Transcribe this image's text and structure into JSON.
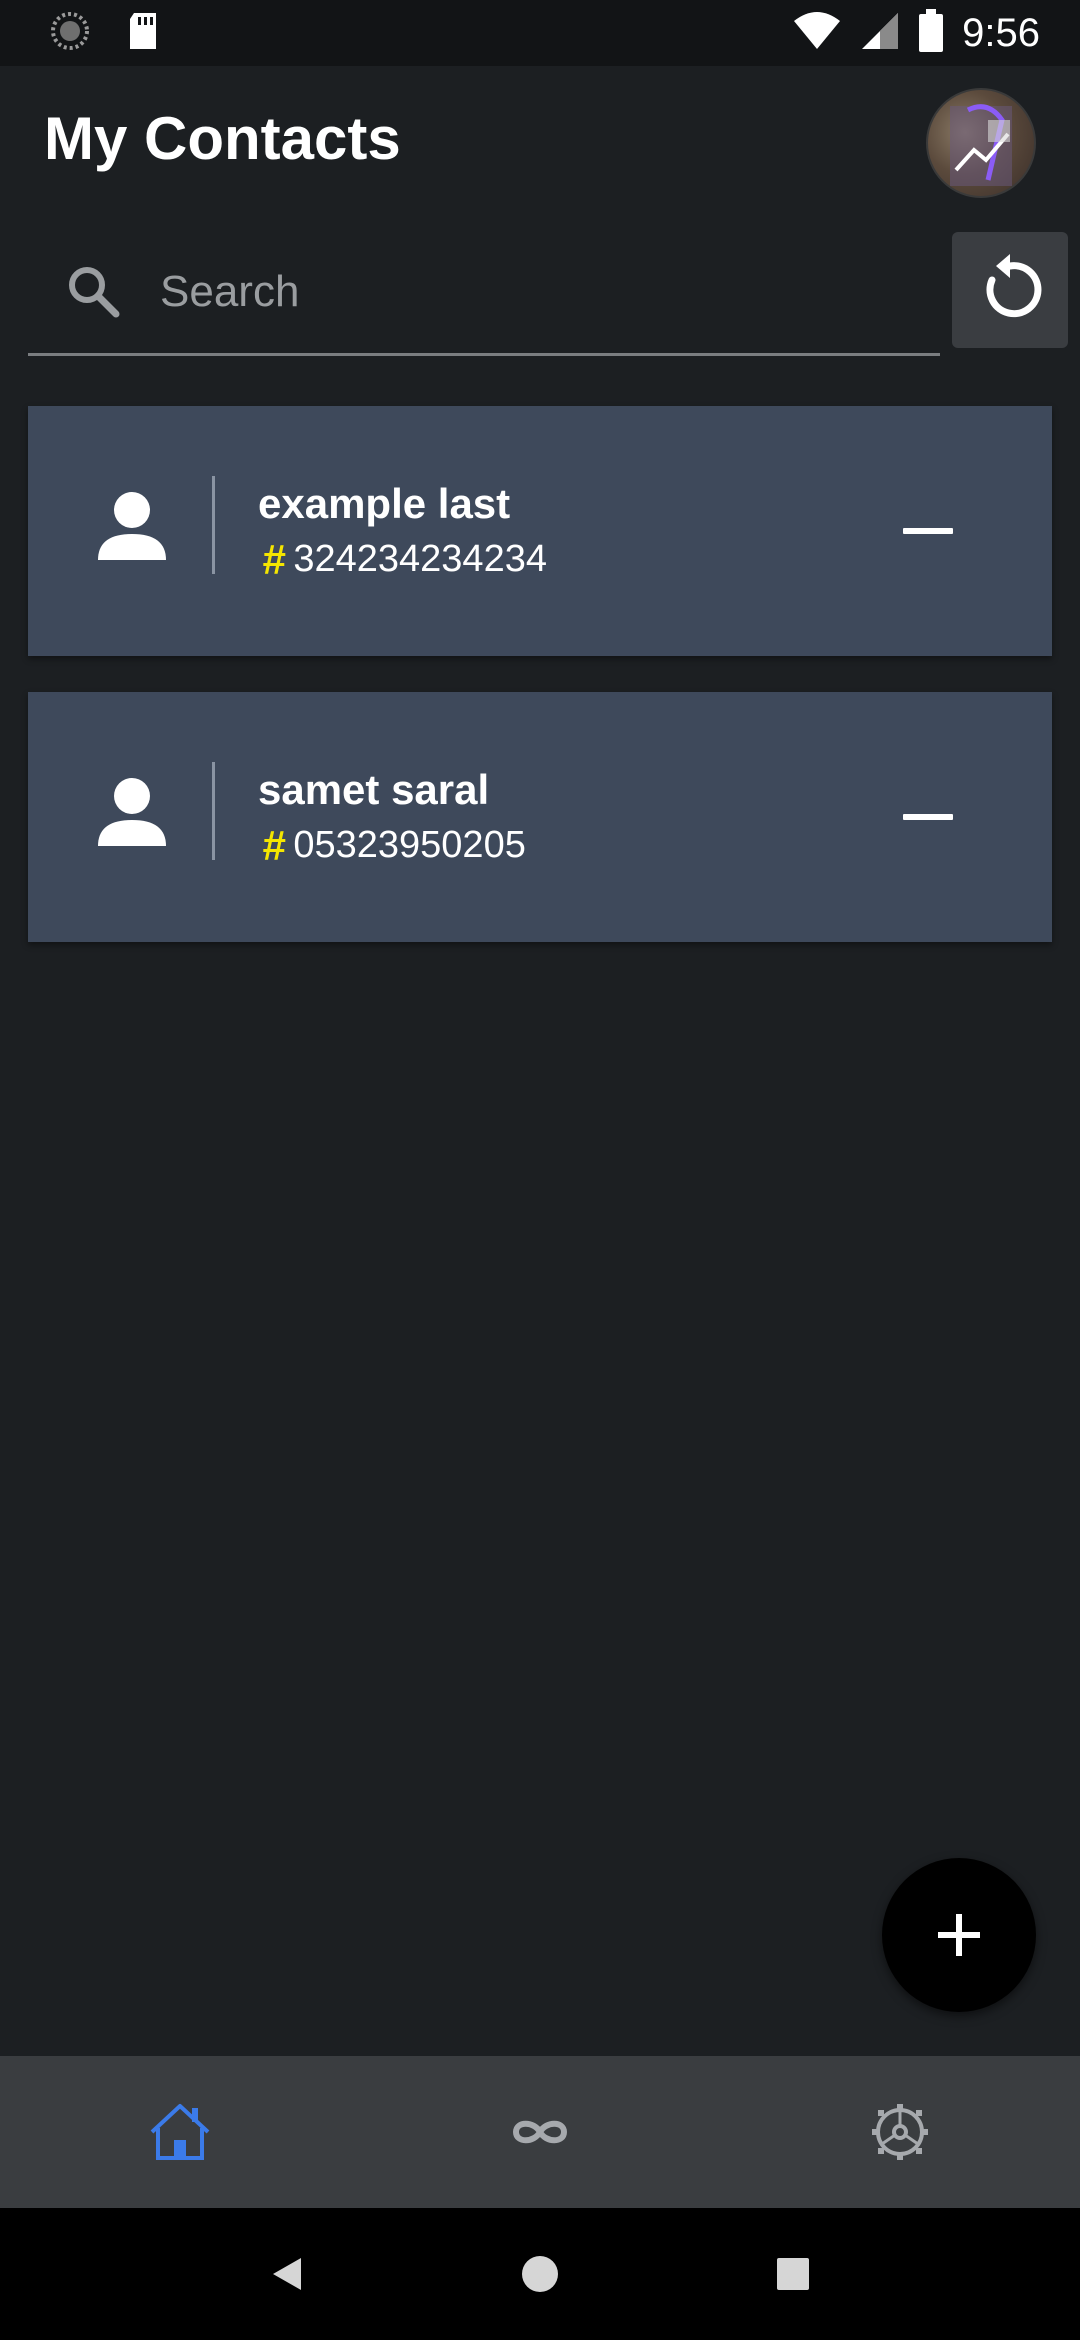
{
  "status_bar": {
    "time": "9:56",
    "icons": [
      "sync-icon",
      "sd-card-icon",
      "wifi-icon",
      "signal-icon",
      "battery-icon"
    ]
  },
  "header": {
    "title": "My Contacts"
  },
  "search": {
    "placeholder": "Search",
    "value": ""
  },
  "contacts": [
    {
      "name": "example last",
      "phone": "324234234234"
    },
    {
      "name": "samet saral",
      "phone": "05323950205"
    }
  ],
  "bottom_nav": {
    "items": [
      {
        "icon": "home-icon",
        "active": true
      },
      {
        "icon": "infinity-icon",
        "active": false
      },
      {
        "icon": "settings-icon",
        "active": false
      }
    ]
  },
  "colors": {
    "background": "#1c1f22",
    "card": "#3e495b",
    "accent": "#3b7be9",
    "hash": "#f5e600",
    "nav_bar": "#3a3d40"
  }
}
